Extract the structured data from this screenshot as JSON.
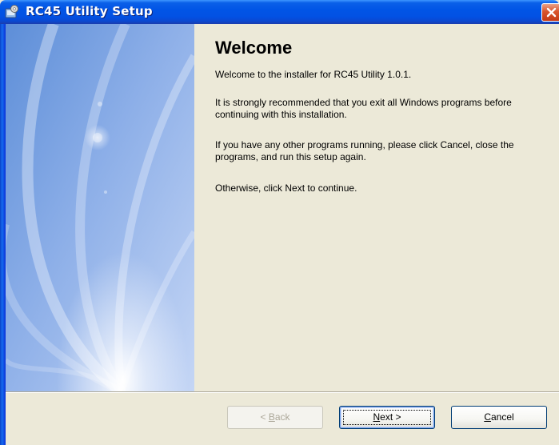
{
  "window": {
    "title": "RC45 Utility Setup"
  },
  "icons": {
    "app": "setup-app-icon",
    "close": "close-icon"
  },
  "content": {
    "heading": "Welcome",
    "paragraphs": [
      "Welcome to the installer for RC45 Utility 1.0.1.",
      "It is strongly recommended that you exit all Windows programs before continuing with this installation.",
      "If you have any other programs running, please click Cancel, close the programs, and run this setup again.",
      "Otherwise, click Next to continue."
    ]
  },
  "buttons": {
    "back": {
      "prefix": "< ",
      "mnemonic": "B",
      "rest": "ack",
      "enabled": false
    },
    "next": {
      "mnemonic": "N",
      "rest": "ext >",
      "enabled": true
    },
    "cancel": {
      "mnemonic": "C",
      "rest": "ancel",
      "enabled": true
    }
  },
  "colors": {
    "titlebar": "#0155E6",
    "dialog_background": "#ECE9D8",
    "banner_base": "#A9C0EE",
    "close_button": "#D9542B"
  }
}
